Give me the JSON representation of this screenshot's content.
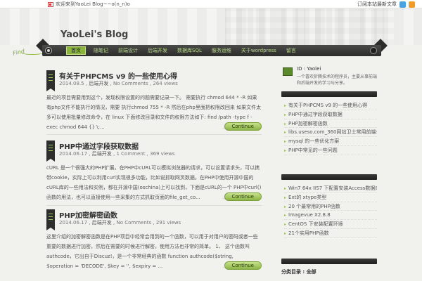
{
  "topbar": {
    "welcome_text": "欢迎来到YaoLei Blog~~o(n_n)o",
    "right_text": "订阅本站最新文章"
  },
  "header": {
    "site_title": "YaoLei's Blog",
    "find_label": "Find"
  },
  "nav": {
    "items": [
      {
        "label": "首页",
        "active": true
      },
      {
        "label": "随笔记"
      },
      {
        "label": "前端设计"
      },
      {
        "label": "后端开发"
      },
      {
        "label": "数据库SQL"
      },
      {
        "label": "服务运维"
      },
      {
        "label": "关于wordpress"
      },
      {
        "label": "留言"
      }
    ]
  },
  "posts": [
    {
      "title": "有关于PHPCMS v9 的一些使用心得",
      "date": "2014.08.5",
      "sep1": " , ",
      "category": "后端开发",
      "sep2": " , ",
      "comments": "No Comments",
      "views": " , 264 views",
      "excerpt": "最近的项目需要用到这个，发现权限设置的问题需要记录一下。 需要执行 chmod 644 * -R 如果有php文件不能执行的情况，需要 执行chmod 755 * -R 然后在php里面把权限改回来 如果文件太多可以使用批量修改命令，在 linux 下面修改目录和文件的权限方法如下: find /path -type f -exec chmod 644 {} \\;...",
      "continue_label": "Continue"
    },
    {
      "title": "PHP中通过字段获取数据",
      "date": "2014.06.17",
      "sep1": " , ",
      "category": "后端开发",
      "sep2": " , ",
      "comments": "1 Comment",
      "views": " , 369 views",
      "excerpt": "cURL 是一个很强大的PHP扩展，在PHP中cURL可以模拟浏览器的请求，可以设置请求头，可以携带cookie，实际上可以利用curl实现很多功能，比如说抓取网页数据。在PHP中使用开源中国的cURL库的一些用法和实例，都在开源中国(oschina)上可以找到，下面是cURL的一个 PHP中curl()函数的用法，也可以直接使用一些采集的方式抓取页面的file_get_co...",
      "continue_label": "Continue"
    },
    {
      "title": "PHP加密解密函数",
      "date": "2014.06.17",
      "sep1": " , ",
      "category": "后端开发",
      "sep2": " , ",
      "comments": "No Comments",
      "views": " , 291 views",
      "excerpt": "这里介绍的加密解密函数是在PHP项目中经常会用到的一个函数，可以用于对用户的密码或者一些重要的数据进行加密，然后在需要的时候进行解密，使用方法也非常的简单。 1、 这个函数叫authcode，它出自于Discuz!，是一个非常经典的函数 function authcode($string, $operation = 'DECODE', $key = '', $expiry = ...",
      "continue_label": "Continue"
    }
  ],
  "sidebar": {
    "profile_id": "ID : Yaolei",
    "profile_desc": "一个喜欢折腾技术的程序员，主要从事前端和后端开发的学习与分享。",
    "recent_posts": [
      "有关于PHPCMS v9 的一些使用心得",
      "PHP中通过字段获取数据",
      "PHP加密解密函数",
      "libs.useso.com_360网站卫士常用前端公共库CDN服务",
      "mysql 的一些优化方案",
      "PHP中常见的一些问题"
    ],
    "popular_posts": [
      "Win7 64x IIS7 下配置安装Access数据库的问题",
      "Ext的 xtype类型",
      "20 个最常用的PHP函数",
      "Imagevue X2.8.8",
      "CentOS 下安装配置环境",
      "21个实用PHP函数"
    ],
    "bottom_label": "分类目录 : 全部"
  },
  "colors": {
    "accent": "#8bb43c",
    "nav_bg": "#2c2c2a",
    "page_bg": "#f1f1ee"
  }
}
